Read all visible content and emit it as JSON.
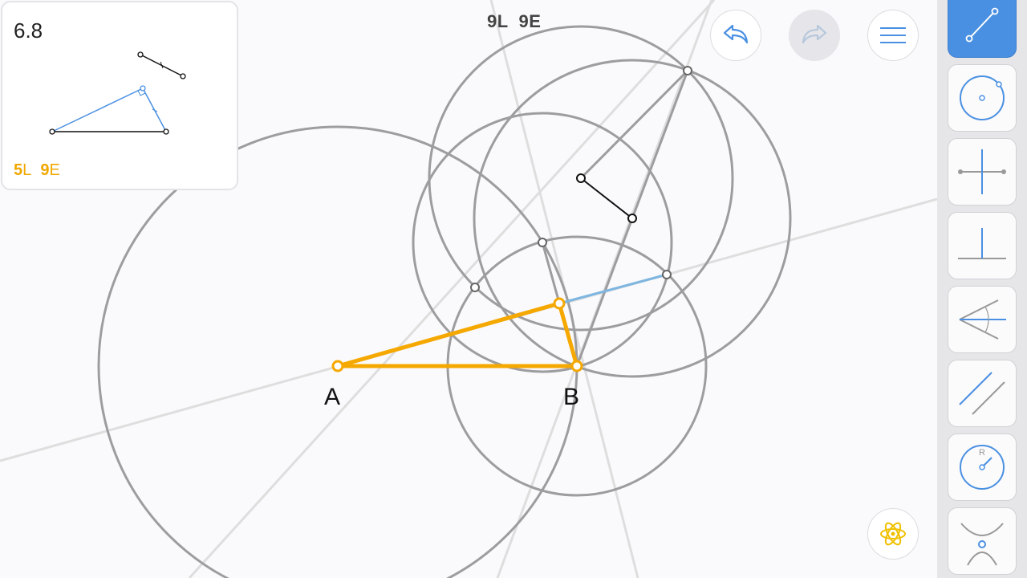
{
  "goal": {
    "level": "6.8",
    "score_l": "5",
    "score_l_unit": "L",
    "score_e": "9",
    "score_e_unit": "E"
  },
  "moves": "9L  9E",
  "points": {
    "a_label": "A",
    "b_label": "B"
  },
  "buttons": {
    "undo": "undo-icon",
    "redo": "redo-icon",
    "menu": "menu-icon",
    "hint": "atom-icon"
  },
  "tools": [
    {
      "name": "line-tool",
      "icon": "line-icon",
      "active": true
    },
    {
      "name": "circle-tool",
      "icon": "circle-icon",
      "active": false
    },
    {
      "name": "perpendicular-bisector-tool",
      "icon": "perpendicular-bisector-icon",
      "active": false
    },
    {
      "name": "perpendicular-tool",
      "icon": "perpendicular-icon",
      "active": false
    },
    {
      "name": "angle-bisector-tool",
      "icon": "angle-bisector-icon",
      "active": false
    },
    {
      "name": "parallel-tool",
      "icon": "parallel-icon",
      "active": false
    },
    {
      "name": "compass-tool",
      "icon": "compass-icon",
      "compass_letter": "R",
      "active": false
    },
    {
      "name": "intersect-tool",
      "icon": "intersect-icon",
      "active": false
    }
  ],
  "colors": {
    "accent": "#4a90e2",
    "construction": "#9d9d9f",
    "guide": "#dedede",
    "result": "#f5a800",
    "segment": "#111111",
    "highlight": "#7fb6e0"
  }
}
